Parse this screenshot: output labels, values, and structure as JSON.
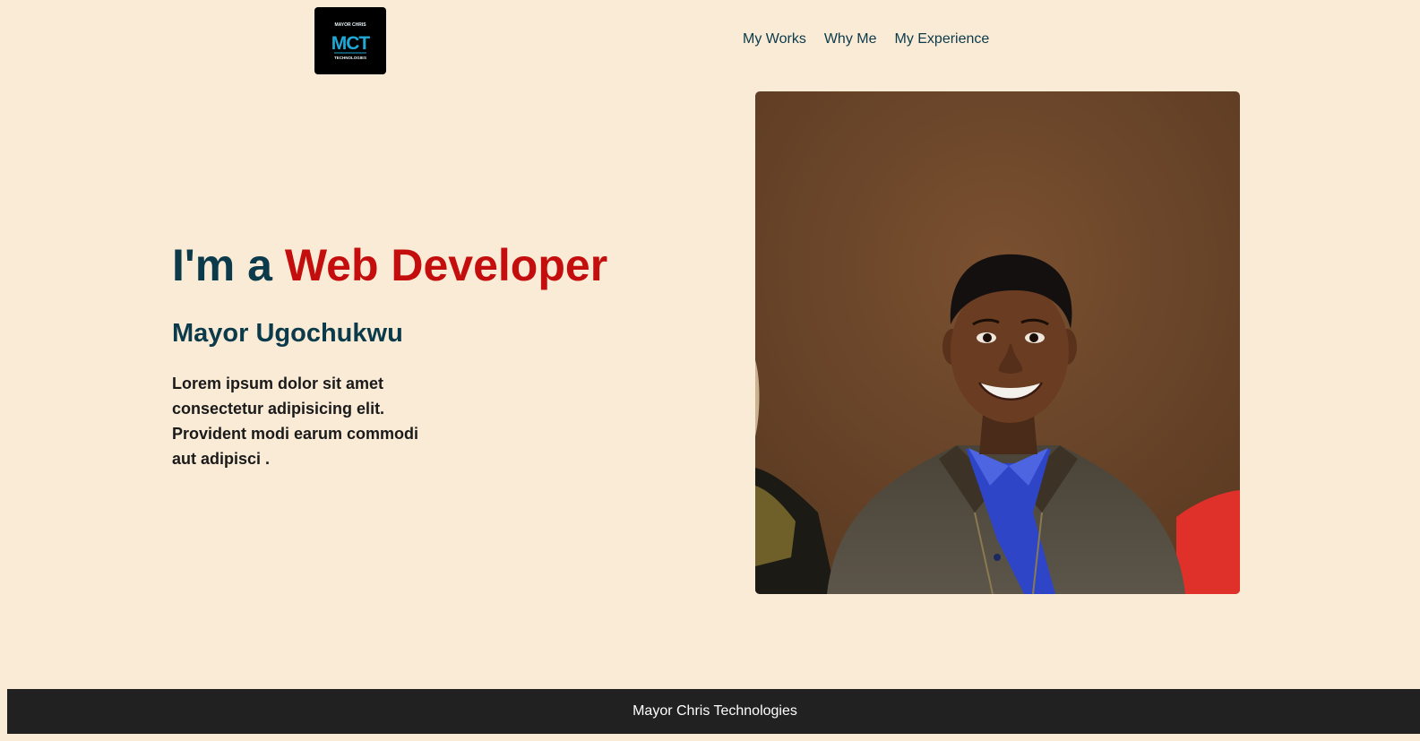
{
  "header": {
    "logo": {
      "text_top": "MAYOR CHRIS",
      "monogram": "MCT",
      "text_bottom": "TECHNOLOGIES"
    },
    "nav": [
      {
        "label": "My Works"
      },
      {
        "label": "Why Me"
      },
      {
        "label": "My Experience"
      }
    ]
  },
  "hero": {
    "title_prefix": "I'm a ",
    "title_highlight": "Web Developer",
    "name": "Mayor Ugochukwu",
    "description": "Lorem ipsum dolor sit amet consectetur adipisicing elit. Provident modi earum commodi aut adipisci ."
  },
  "footer": {
    "text": "Mayor Chris Technologies"
  },
  "colors": {
    "background": "#faebd7",
    "heading": "#0b3a4a",
    "accent": "#c40e0e",
    "footer_bg": "#212121"
  }
}
